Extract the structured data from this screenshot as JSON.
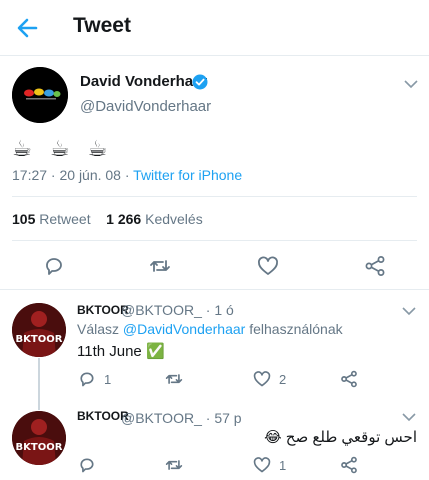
{
  "header": {
    "title": "Tweet"
  },
  "tweet": {
    "name": "David Vonderhaar",
    "handle": "@DavidVonderhaar",
    "text": "☕ ☕ ☕",
    "time": "17:27 · 20 jún. 08 · ",
    "source": "Twitter for iPhone",
    "retweets": "105",
    "retweets_label": "Retweet",
    "likes": "1 266",
    "likes_label": "Kedvelés"
  },
  "replies": [
    {
      "name": "BKTOOR",
      "handle": "@BKTOOR_",
      "time": " · 1 ó",
      "reply_prefix": "Válasz ",
      "reply_to": "@DavidVonderhaar",
      "reply_suffix": " felhasználónak",
      "text": "11th June ✅",
      "reply_count": "1",
      "retweet_count": "",
      "like_count": "2",
      "avatar_label": "BKTOOR"
    },
    {
      "name": "BKTOOR",
      "handle": "@BKTOOR_",
      "time": " · 57 p",
      "text": "احس توقعي طلع صح 😂",
      "reply_count": "",
      "retweet_count": "",
      "like_count": "1",
      "avatar_label": "BKTOOR"
    }
  ],
  "colors": {
    "accent": "#1da1f2",
    "muted": "#657786",
    "border": "#e6ecf0"
  }
}
